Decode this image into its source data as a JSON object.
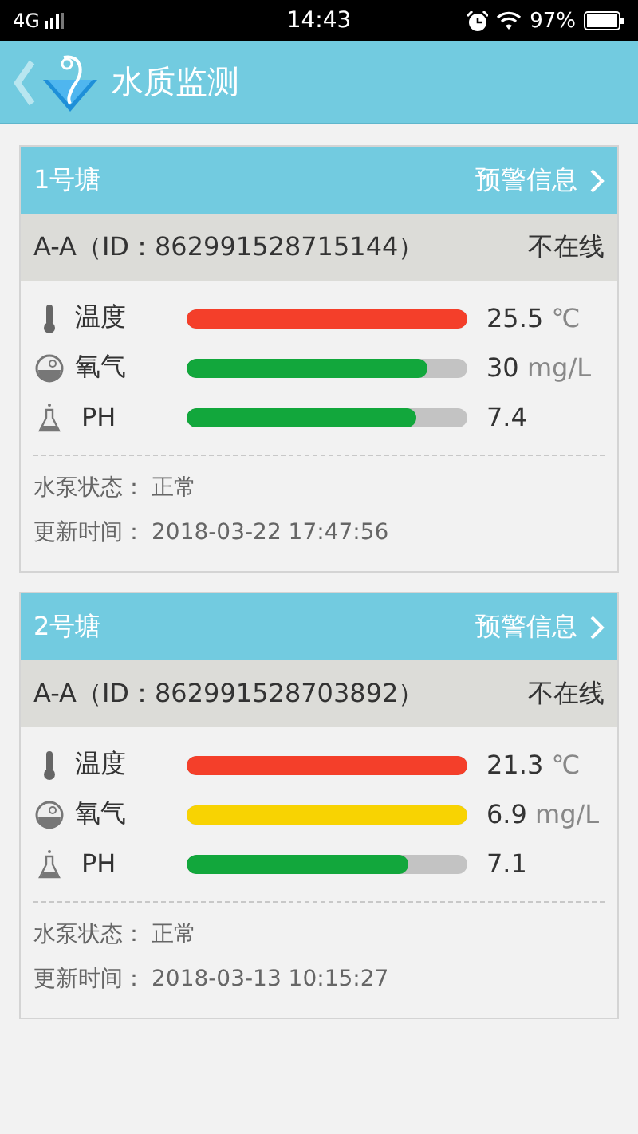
{
  "status_bar": {
    "network": "4G",
    "time": "14:43",
    "battery": "97%"
  },
  "header": {
    "title": "水质监测"
  },
  "ponds": [
    {
      "name": "1号塘",
      "alert_link": "预警信息",
      "device": "A-A（ID：862991528715144）",
      "connection": "不在线",
      "sensors": [
        {
          "kind": "temperature",
          "label": "温度",
          "level": 1,
          "color": "#f43f2a",
          "value": "25.5",
          "unit": "℃"
        },
        {
          "kind": "oxygen",
          "label": "氧气",
          "level": 0.86,
          "color": "#12a73c",
          "value": "30",
          "unit": "mg/L"
        },
        {
          "kind": "ph",
          "label": "PH",
          "level": 0.82,
          "color": "#12a73c",
          "value": "7.4"
        }
      ],
      "pump_label": "水泵状态：",
      "pump_status": "正常",
      "update_label": "更新时间：",
      "update_time": "2018-03-22 17:47:56"
    },
    {
      "name": "2号塘",
      "alert_link": "预警信息",
      "device": "A-A（ID：862991528703892）",
      "connection": "不在线",
      "sensors": [
        {
          "kind": "temperature",
          "label": "温度",
          "level": 1,
          "color": "#f43f2a",
          "value": "21.3",
          "unit": "℃"
        },
        {
          "kind": "oxygen",
          "label": "氧气",
          "level": 1,
          "color": "#f8d302",
          "value": "6.9",
          "unit": "mg/L"
        },
        {
          "kind": "ph",
          "label": "PH",
          "level": 0.79,
          "color": "#12a73c",
          "value": "7.1"
        }
      ],
      "pump_label": "水泵状态：",
      "pump_status": "正常",
      "update_label": "更新时间：",
      "update_time": "2018-03-13 10:15:27"
    }
  ]
}
